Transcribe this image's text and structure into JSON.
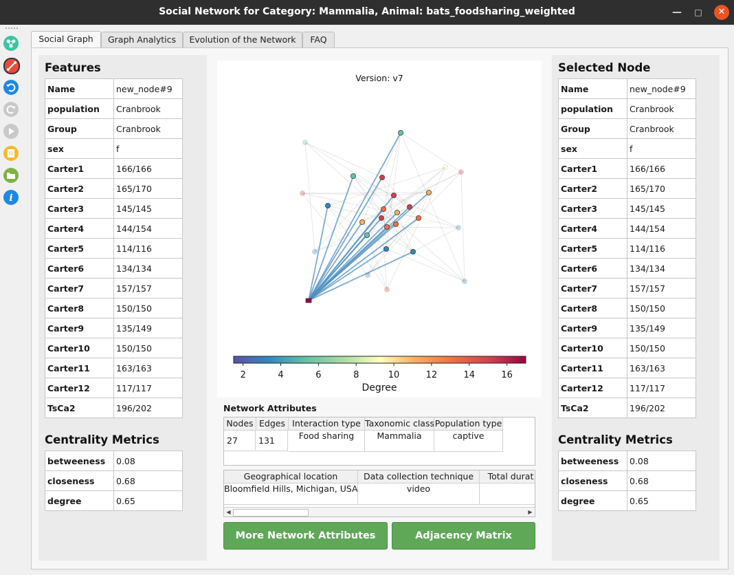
{
  "window": {
    "title": "Social Network for Category: Mammalia, Animal: bats_foodsharing_weighted"
  },
  "toolbar": {
    "icons": [
      "network-icon",
      "edge-tool-icon",
      "undo-icon",
      "redo-icon",
      "play-icon",
      "notes-icon",
      "open-folder-icon",
      "info-icon"
    ]
  },
  "tabs": [
    "Social Graph",
    "Graph Analytics",
    "Evolution of the Network",
    "FAQ"
  ],
  "features": {
    "heading": "Features",
    "rows": [
      [
        "Name",
        "new_node#9"
      ],
      [
        "population",
        "Cranbrook"
      ],
      [
        "Group",
        "Cranbrook"
      ],
      [
        "sex",
        "f"
      ],
      [
        "Carter1",
        "166/166"
      ],
      [
        "Carter2",
        "165/170"
      ],
      [
        "Carter3",
        "145/145"
      ],
      [
        "Carter4",
        "144/154"
      ],
      [
        "Carter5",
        "114/116"
      ],
      [
        "Carter6",
        "134/134"
      ],
      [
        "Carter7",
        "157/157"
      ],
      [
        "Carter8",
        "150/150"
      ],
      [
        "Carter9",
        "135/149"
      ],
      [
        "Carter10",
        "150/150"
      ],
      [
        "Carter11",
        "163/163"
      ],
      [
        "Carter12",
        "117/117"
      ],
      [
        "TsCa2",
        "196/202"
      ]
    ]
  },
  "centrality": {
    "heading": "Centrality Metrics",
    "rows": [
      [
        "betweeness",
        "0.08"
      ],
      [
        "closeness",
        "0.68"
      ],
      [
        "degree",
        "0.65"
      ]
    ]
  },
  "selected": {
    "heading": "Selected Node",
    "rows": [
      [
        "Name",
        "new_node#9"
      ],
      [
        "population",
        "Cranbrook"
      ],
      [
        "Group",
        "Cranbrook"
      ],
      [
        "sex",
        "f"
      ],
      [
        "Carter1",
        "166/166"
      ],
      [
        "Carter2",
        "165/170"
      ],
      [
        "Carter3",
        "145/145"
      ],
      [
        "Carter4",
        "144/154"
      ],
      [
        "Carter5",
        "114/116"
      ],
      [
        "Carter6",
        "134/134"
      ],
      [
        "Carter7",
        "157/157"
      ],
      [
        "Carter8",
        "150/150"
      ],
      [
        "Carter9",
        "135/149"
      ],
      [
        "Carter10",
        "150/150"
      ],
      [
        "Carter11",
        "163/163"
      ],
      [
        "Carter12",
        "117/117"
      ],
      [
        "TsCa2",
        "196/202"
      ]
    ],
    "centrality_heading": "Centrality Metrics",
    "centrality_rows": [
      [
        "betweeness",
        "0.08"
      ],
      [
        "closeness",
        "0.68"
      ],
      [
        "degree",
        "0.65"
      ]
    ]
  },
  "graph": {
    "version_label": "Version: v7",
    "colorbar": {
      "label": "Degree",
      "ticks": [
        "2",
        "4",
        "6",
        "8",
        "10",
        "12",
        "14",
        "16"
      ],
      "min": 1.5,
      "max": 17
    }
  },
  "network_attributes": {
    "title": "Network Attributes",
    "table1_headers": [
      "Nodes",
      "Edges",
      "Interaction type",
      "Taxonomic class",
      "Population type"
    ],
    "table1_values": [
      "27",
      "131",
      "Food sharing",
      "Mammalia",
      "captive"
    ],
    "table2_headers": [
      "Geographical location",
      "Data collection technique",
      "Total durat"
    ],
    "table2_values": [
      "Bloomfield Hills, Michigan, USA",
      "video",
      ""
    ]
  },
  "buttons": {
    "more": "More Network Attributes",
    "adjacency": "Adjacency Matrix"
  },
  "colors": {
    "accent_green": "#5fa857",
    "close_button": "#e95420",
    "title_bar": "#2f2f2f"
  }
}
